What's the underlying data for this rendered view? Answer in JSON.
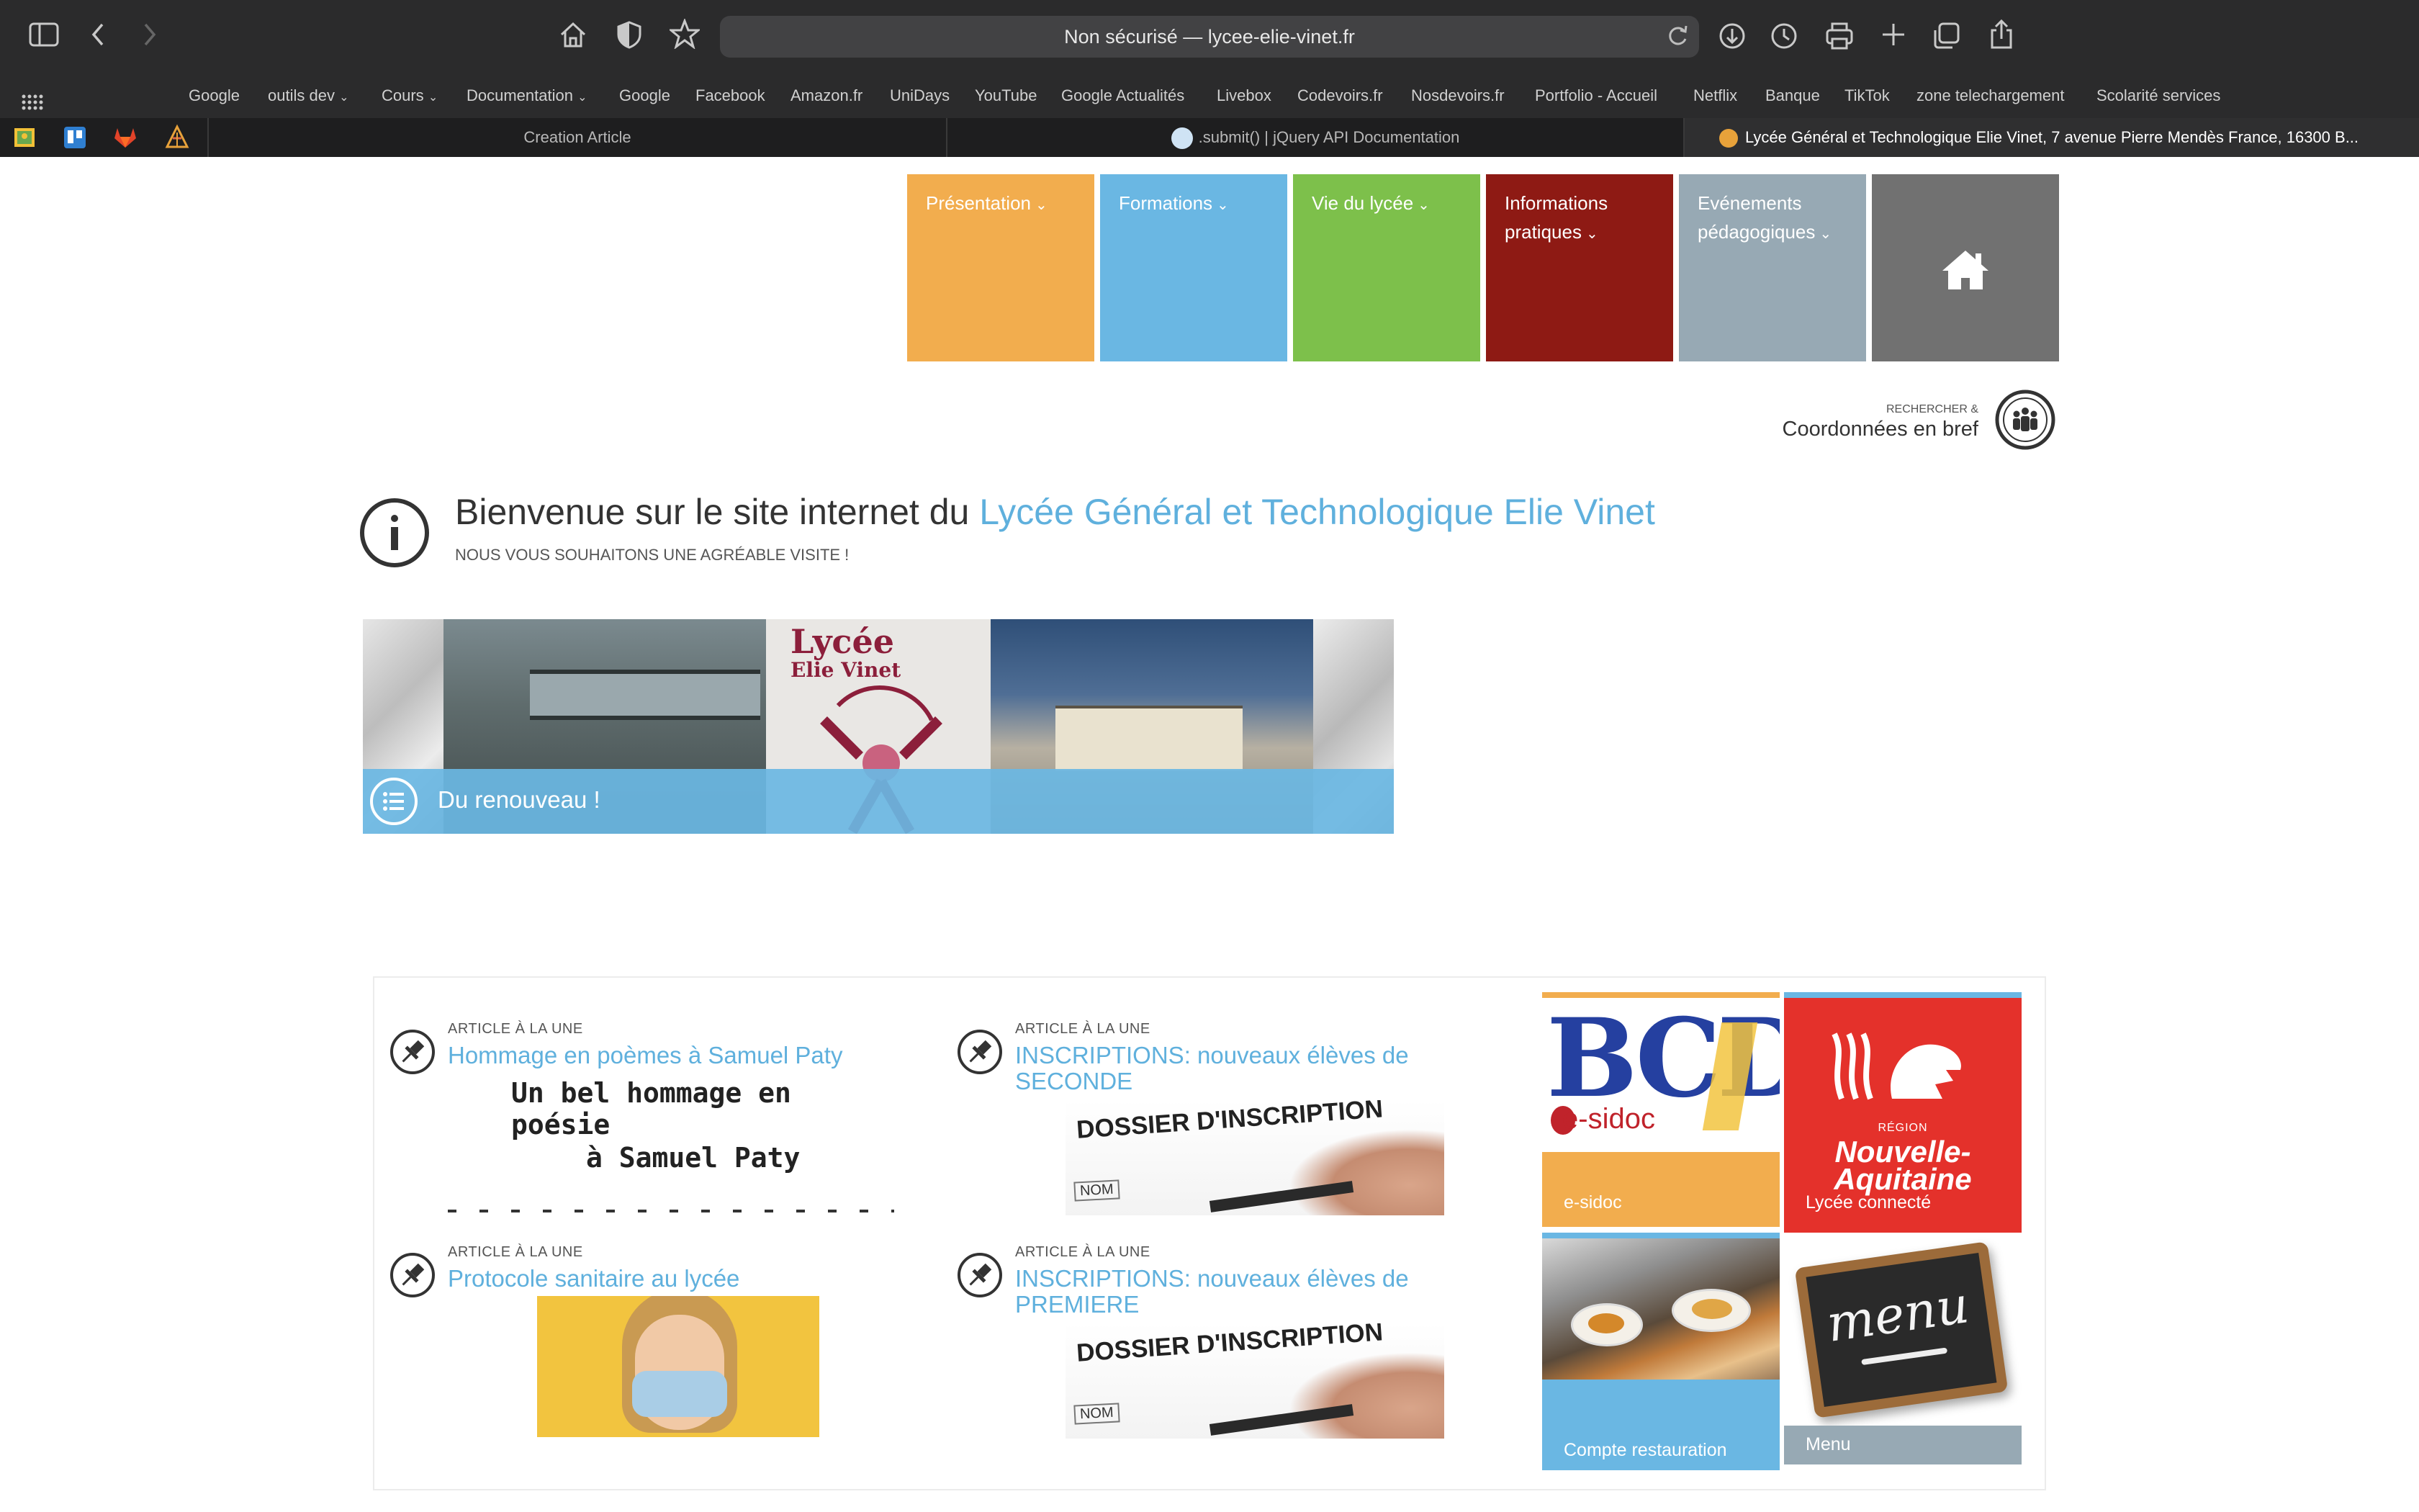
{
  "browser": {
    "address": "Non sécurisé — lycee-elie-vinet.fr",
    "favorites": [
      "Google",
      "outils dev",
      "Cours",
      "Documentation",
      "Google",
      "Facebook",
      "Amazon.fr",
      "UniDays",
      "YouTube",
      "Google Actualités",
      "Livebox",
      "Codevoirs.fr",
      "Nosdevoirs.fr",
      "Portfolio - Accueil",
      "Netflix",
      "Banque",
      "TikTok",
      "zone telechargement",
      "Scolarité services"
    ],
    "favorites_with_menu": [
      "outils dev",
      "Cours",
      "Documentation"
    ],
    "tabs": [
      {
        "label": "Creation Article"
      },
      {
        "label": ".submit() | jQuery API Documentation"
      },
      {
        "label": "Lycée Général et Technologique Elie Vinet, 7 avenue Pierre Mendès France, 16300 B..."
      }
    ]
  },
  "nav": {
    "items": [
      {
        "label": "Présentation",
        "color": "#f2ad4e"
      },
      {
        "label": "Formations",
        "color": "#6ab7e3"
      },
      {
        "label": "Vie du lycée",
        "color": "#7dc04b"
      },
      {
        "label": "Informations pratiques",
        "color": "#8e1a14"
      },
      {
        "label": "Evénements pédagogiques",
        "color": "#97a9b4"
      }
    ],
    "home_color": "#717171"
  },
  "search": {
    "kicker": "RECHERCHER &",
    "label": "Coordonnées en bref"
  },
  "welcome": {
    "title_prefix": "Bienvenue sur le site internet du",
    "title_link": "Lycée Général et Technologique Elie Vinet",
    "subtitle": "NOUS VOUS SOUHAITONS UNE AGRÉABLE VISITE !"
  },
  "banner": {
    "caption": "Du renouveau !",
    "logo_line1": "Lycée",
    "logo_line2": "Elie Vinet"
  },
  "articles": [
    {
      "kicker": "ARTICLE À LA UNE",
      "title": "Hommage en poèmes à Samuel Paty",
      "image_line1": "Un bel hommage en poésie",
      "image_line2": "à Samuel Paty"
    },
    {
      "kicker": "ARTICLE À LA UNE",
      "title": "INSCRIPTIONS: nouveaux élèves de SECONDE",
      "image_text": "DOSSIER D'INSCRIPTION",
      "image_field": "NOM"
    },
    {
      "kicker": "ARTICLE À LA UNE",
      "title": "Protocole sanitaire au lycée"
    },
    {
      "kicker": "ARTICLE À LA UNE",
      "title": "INSCRIPTIONS: nouveaux élèves de PREMIERE",
      "image_text": "DOSSIER D'INSCRIPTION",
      "image_field": "NOM"
    }
  ],
  "quicklinks": [
    {
      "label": "e-sidoc",
      "logo": "BCDI",
      "logo_sub": "e-sidoc"
    },
    {
      "label": "Lycée connecté",
      "logo_top": "RÉGION",
      "logo_line1": "Nouvelle-",
      "logo_line2": "Aquitaine"
    },
    {
      "label": "Compte restauration"
    },
    {
      "label": "Menu",
      "chalk": "menu"
    }
  ]
}
